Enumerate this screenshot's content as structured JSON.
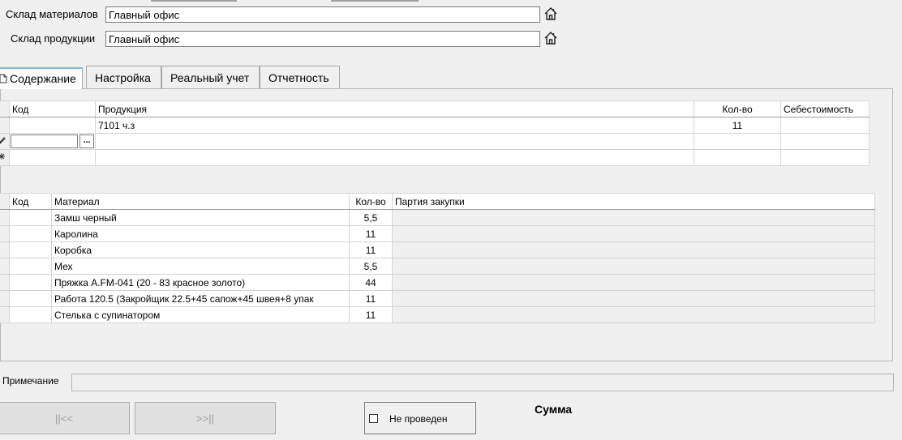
{
  "header": {
    "materials_label": "Склад материалов",
    "materials_value": "Главный офис",
    "products_label": "Склад продукции",
    "products_value": "Главный офис"
  },
  "tabs": [
    {
      "label": "Содержание",
      "active": true
    },
    {
      "label": "Настройка",
      "active": false
    },
    {
      "label": "Реальный учет",
      "active": false
    },
    {
      "label": "Отчетность",
      "active": false
    }
  ],
  "products_grid": {
    "columns": [
      "Код",
      "Продукция",
      "Кол-во",
      "Себестоимость"
    ],
    "rows": [
      {
        "code": "",
        "product": "7101 ч.з",
        "qty": "11",
        "cost": ""
      }
    ],
    "edit_button": "..."
  },
  "materials_grid": {
    "columns": [
      "Код",
      "Материал",
      "Кол-во",
      "Партия закупки"
    ],
    "rows": [
      {
        "code": "",
        "material": "Замш черный",
        "qty": "5,5",
        "batch": ""
      },
      {
        "code": "",
        "material": "Каролина",
        "qty": "11",
        "batch": ""
      },
      {
        "code": "",
        "material": "Коробка",
        "qty": "11",
        "batch": ""
      },
      {
        "code": "",
        "material": "Мех",
        "qty": "5,5",
        "batch": ""
      },
      {
        "code": "",
        "material": "Пряжка A.FM-041 (20 - 83 красное золото)",
        "qty": "44",
        "batch": ""
      },
      {
        "code": "",
        "material": "Работа 120.5 (Закройщик 22.5+45 сапож+45 швея+8 упак",
        "qty": "11",
        "batch": ""
      },
      {
        "code": "",
        "material": "Стелька с супинатором",
        "qty": "11",
        "batch": ""
      }
    ]
  },
  "footer": {
    "note_label": "Примечание",
    "note_value": "",
    "prev_button": "||<<",
    "next_button": ">>||",
    "status_label": "Не проведен",
    "sum_label": "Сумма"
  },
  "icons": {
    "home": "home-icon",
    "new_document": "document-icon",
    "edit_row": "pencil-icon"
  }
}
